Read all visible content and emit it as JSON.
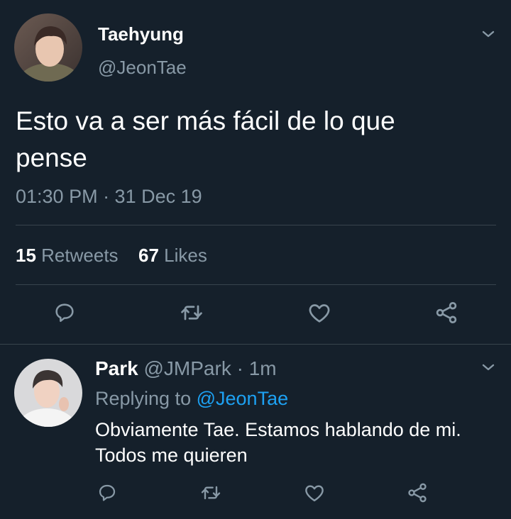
{
  "main_tweet": {
    "author_name": "Taehyung",
    "author_handle": "@JeonTae",
    "text_line1": "Esto va a ser más fácil de lo que",
    "text_line2": "pense",
    "timestamp": "01:30 PM · 31 Dec 19",
    "retweets_count": "15",
    "retweets_label": "Retweets",
    "likes_count": "67",
    "likes_label": "Likes"
  },
  "reply": {
    "author_name": "Park",
    "author_handle": "@JMPark",
    "time": "· 1m",
    "replying_prefix": "Replying to",
    "replying_to": "@JeonTae",
    "text_line1": "Obviamente Tae. Estamos hablando de mi.",
    "text_line2": "Todos me quieren"
  },
  "icons": {
    "menu": "chevron-down-icon",
    "reply": "reply-icon",
    "retweet": "retweet-icon",
    "like": "heart-icon",
    "share": "share-icon"
  },
  "colors": {
    "background": "#15202b",
    "muted": "#8899a6",
    "accent": "#1da1f2",
    "divider": "#38444d"
  }
}
